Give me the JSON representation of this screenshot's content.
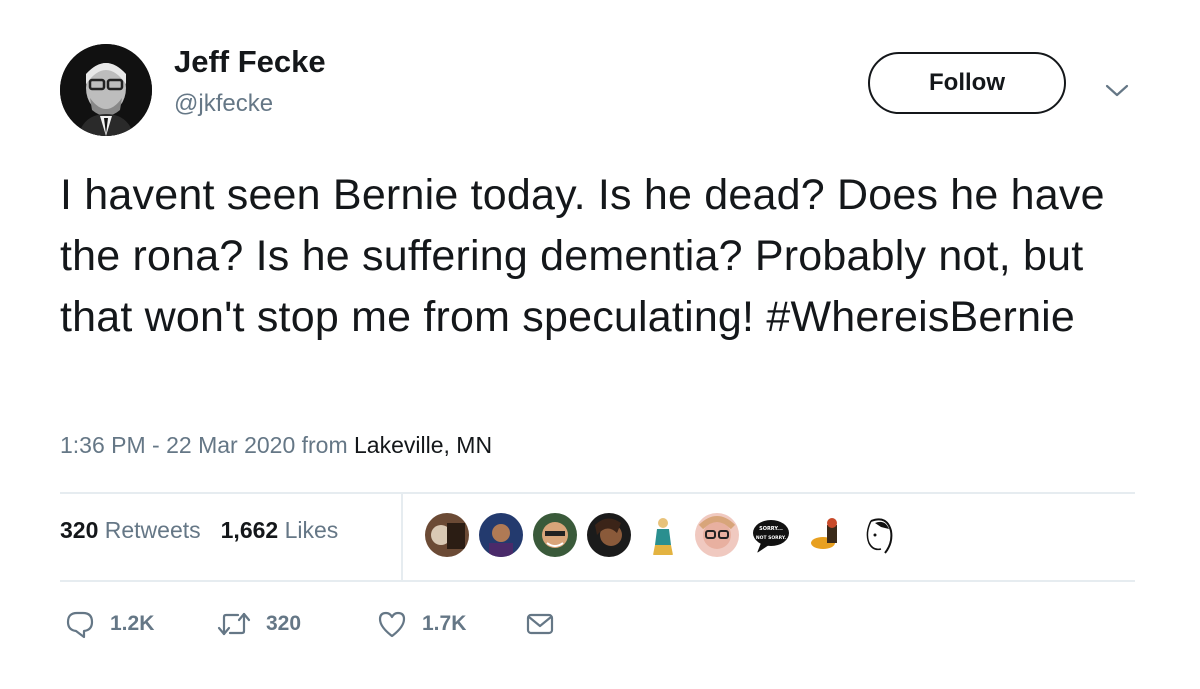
{
  "user": {
    "name": "Jeff Fecke",
    "handle": "@jkfecke"
  },
  "follow_label": "Follow",
  "tweet": {
    "text": "I havent seen Bernie today. Is he dead? Does he have the rona? Is he suffering dementia? Probably not, but that won't stop me from speculating! #WhereisBernie",
    "time": "1:36 PM - 22 Mar 2020",
    "from_label": "from",
    "location": "Lakeville, MN"
  },
  "stats": {
    "retweets_count": "320",
    "retweets_label": "Retweets",
    "likes_count": "1,662",
    "likes_label": "Likes"
  },
  "liker_avatars": [
    "liker-1",
    "liker-2",
    "liker-3",
    "liker-4",
    "liker-5",
    "liker-6",
    "liker-7",
    "liker-8",
    "liker-9"
  ],
  "liker_badge_text": "SORRY... NOT SORRY.",
  "actions": {
    "reply_count": "1.2K",
    "retweet_count": "320",
    "like_count": "1.7K"
  },
  "icons": {
    "reply": "reply-icon",
    "retweet": "retweet-icon",
    "like": "heart-icon",
    "dm": "mail-icon",
    "more": "chevron-down-icon"
  },
  "colors": {
    "text": "#14171a",
    "secondary": "#657786",
    "divider": "#e6ecf0"
  }
}
